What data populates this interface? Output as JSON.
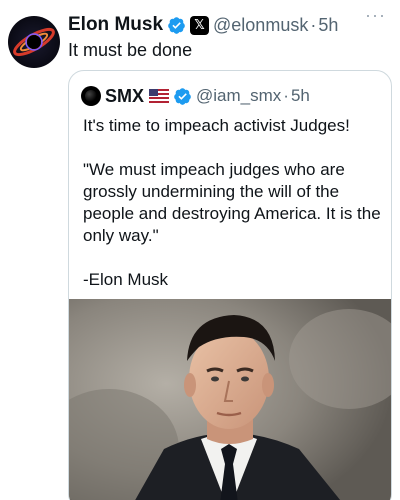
{
  "author": {
    "name": "Elon Musk",
    "handle": "@elonmusk",
    "time": "5h",
    "separator": "·",
    "text": "It must be done"
  },
  "quoted": {
    "name": "SMX",
    "handle": "@iam_smx",
    "time": "5h",
    "separator": "·",
    "paragraphs": [
      "It's time to impeach activist Judges!",
      "\"We must impeach judges who are grossly undermining the will of the people and destroying America. It is the only way.\"",
      "-Elon Musk"
    ]
  },
  "icons": {
    "verified": "verified-badge-icon",
    "x_affiliate": "x-logo-icon",
    "flag": "us-flag-icon",
    "more": "more-icon"
  },
  "colors": {
    "verified": "#1d9bf0",
    "muted": "#536471",
    "border": "#cfd9de"
  }
}
